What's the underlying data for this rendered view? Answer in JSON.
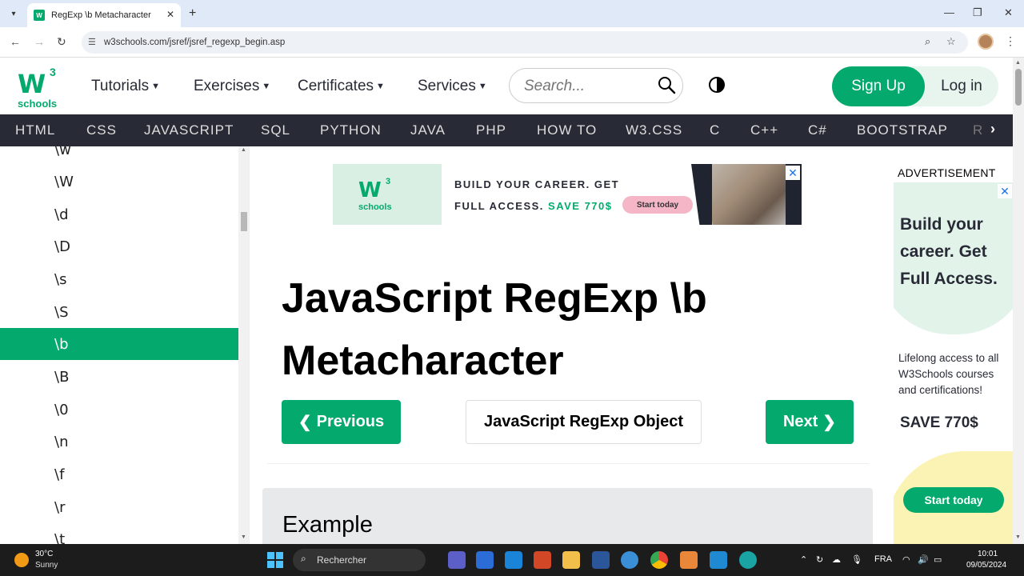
{
  "browser": {
    "tab_title": "RegExp \\b Metacharacter",
    "favicon_text": "W",
    "url": "w3schools.com/jsref/jsref_regexp_begin.asp"
  },
  "site": {
    "logo_mark": "W",
    "logo_super": "3",
    "logo_text": "schools",
    "menu": [
      {
        "label": "Tutorials"
      },
      {
        "label": "Exercises"
      },
      {
        "label": "Certificates"
      },
      {
        "label": "Services"
      }
    ],
    "search_placeholder": "Search...",
    "signup_label": "Sign Up",
    "login_label": "Log in",
    "subnav": [
      "HTML",
      "CSS",
      "JAVASCRIPT",
      "SQL",
      "PYTHON",
      "JAVA",
      "PHP",
      "HOW TO",
      "W3.CSS",
      "C",
      "C++",
      "C#",
      "BOOTSTRAP",
      "R"
    ]
  },
  "sidebar": {
    "items": [
      "\\w",
      "\\W",
      "\\d",
      "\\D",
      "\\s",
      "\\S",
      "\\b",
      "\\B",
      "\\0",
      "\\n",
      "\\f",
      "\\r",
      "\\t"
    ],
    "active": "\\b"
  },
  "banner_ad": {
    "line1": "BUILD YOUR CAREER. GET",
    "line2_prefix": "FULL ACCESS.",
    "line2_highlight": "SAVE 770$",
    "cta": "Start today"
  },
  "main": {
    "title_line1": "JavaScript RegExp \\b",
    "title_line2": "Metacharacter",
    "prev_label": "Previous",
    "center_label": "JavaScript RegExp Object",
    "next_label": "Next",
    "example_heading": "Example"
  },
  "side_ad": {
    "label": "ADVERTISEMENT",
    "headline": "Build your career. Get Full Access.",
    "description": "Lifelong access to all W3Schools courses and certifications!",
    "save": "SAVE 770$",
    "cta": "Start today"
  },
  "taskbar": {
    "temperature": "30°C",
    "condition": "Sunny",
    "search_label": "Rechercher",
    "language": "FRA",
    "time": "10:01",
    "date": "09/05/2024"
  },
  "colors": {
    "w3_green": "#04aa6d",
    "subnav_bg": "#282a35",
    "taskbar_bg": "#1c1c1c"
  }
}
